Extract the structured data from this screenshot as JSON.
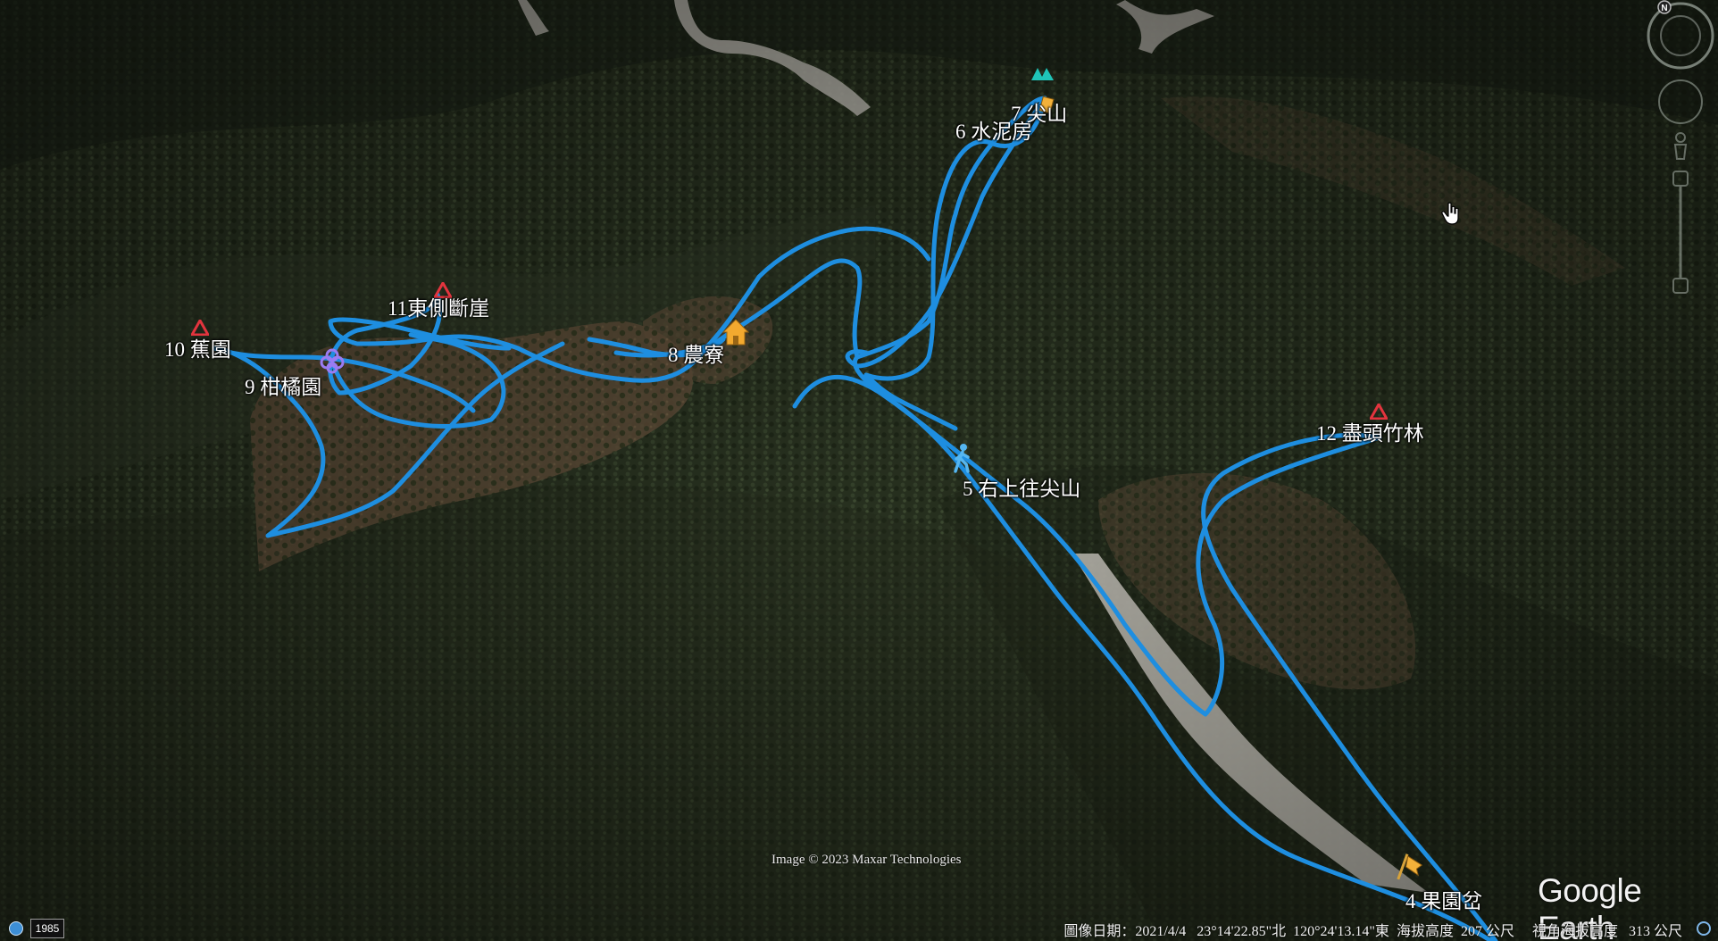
{
  "app": "Google Earth",
  "map": {
    "placemarks": [
      {
        "id": "p4",
        "label": "4 果園岔",
        "icon": "flag-icon"
      },
      {
        "id": "p5",
        "label": "5 右上往尖山",
        "icon": "hiker-icon"
      },
      {
        "id": "p6",
        "label": "6 水泥房",
        "icon": "none"
      },
      {
        "id": "p7",
        "label": "7 尖山",
        "icon": "summit-triangle-icon"
      },
      {
        "id": "p8",
        "label": "8 農寮",
        "icon": "house-icon"
      },
      {
        "id": "p9",
        "label": "9 柑橘園",
        "icon": "fruit-icon"
      },
      {
        "id": "p10",
        "label": "10 蕉園",
        "icon": "red-triangle-icon"
      },
      {
        "id": "p11",
        "label": "11東側斷崖",
        "icon": "red-triangle-icon"
      },
      {
        "id": "p12",
        "label": "12 盡頭竹林",
        "icon": "red-triangle-icon"
      }
    ],
    "track_color": "#1e8ee0",
    "road_color": "#c9c6bd",
    "copyright": "Image © 2023 Maxar Technologies",
    "logo": "Google Earth"
  },
  "status_bar": {
    "imagery_date_label": "圖像日期：",
    "imagery_date": "2021/4/4",
    "latitude": "23°14'22.85\"北",
    "longitude": "120°24'13.14\"東",
    "elevation_label": "海拔高度",
    "elevation": "207 公尺",
    "eye_alt_label": "視角海拔高度",
    "eye_alt": "313 公尺",
    "year": "1985"
  },
  "navigation": {
    "north_label": "N"
  }
}
